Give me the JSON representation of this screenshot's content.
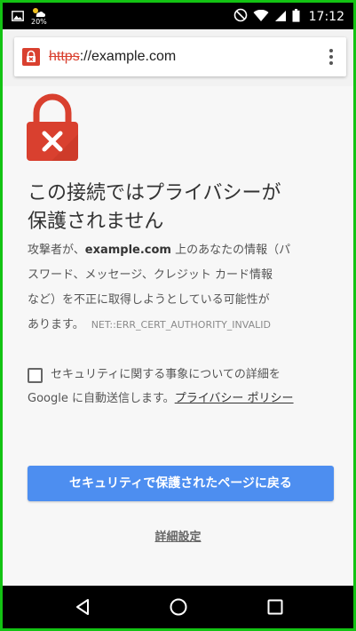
{
  "status_bar": {
    "weather_temp": "20%",
    "time": "17:12",
    "icons": [
      "image-icon",
      "weather-icon",
      "dnd-icon",
      "wifi-icon",
      "signal-icon",
      "battery-icon"
    ]
  },
  "omnibox": {
    "url_scheme": "https",
    "url_rest": "://example.com",
    "lock_icon": "broken-lock-icon",
    "menu_icon": "more-vert-icon"
  },
  "page": {
    "heading_line1": "この接続ではプライバシーが",
    "heading_line2": "保護されません",
    "body_line1_pre": "攻撃者が、",
    "body_line1_domain": "example.com",
    "body_line1_post": " 上のあなたの情報（パ",
    "body_line2": "スワード、メッセージ、クレジット カード情報",
    "body_line3": "など）を不正に取得しようとしている可能性が",
    "body_line4": "あります。",
    "error_code": "NET::ERR_CERT_AUTHORITY_INVALID",
    "checkbox_line1": "セキュリティに関する事象についての詳細を",
    "checkbox_line2_pre": "Google に自動送信します。",
    "privacy_link": "プライバシー ポリシー",
    "checkbox_checked": false,
    "primary_button": "セキュリティで保護されたページに戻る",
    "details_link": "詳細設定"
  },
  "nav_bar": {
    "icons": [
      "back-icon",
      "home-icon",
      "recents-icon"
    ]
  },
  "colors": {
    "accent_red": "#d9402f",
    "button_blue": "#4d8ef0",
    "page_bg": "#f7f7f7"
  }
}
